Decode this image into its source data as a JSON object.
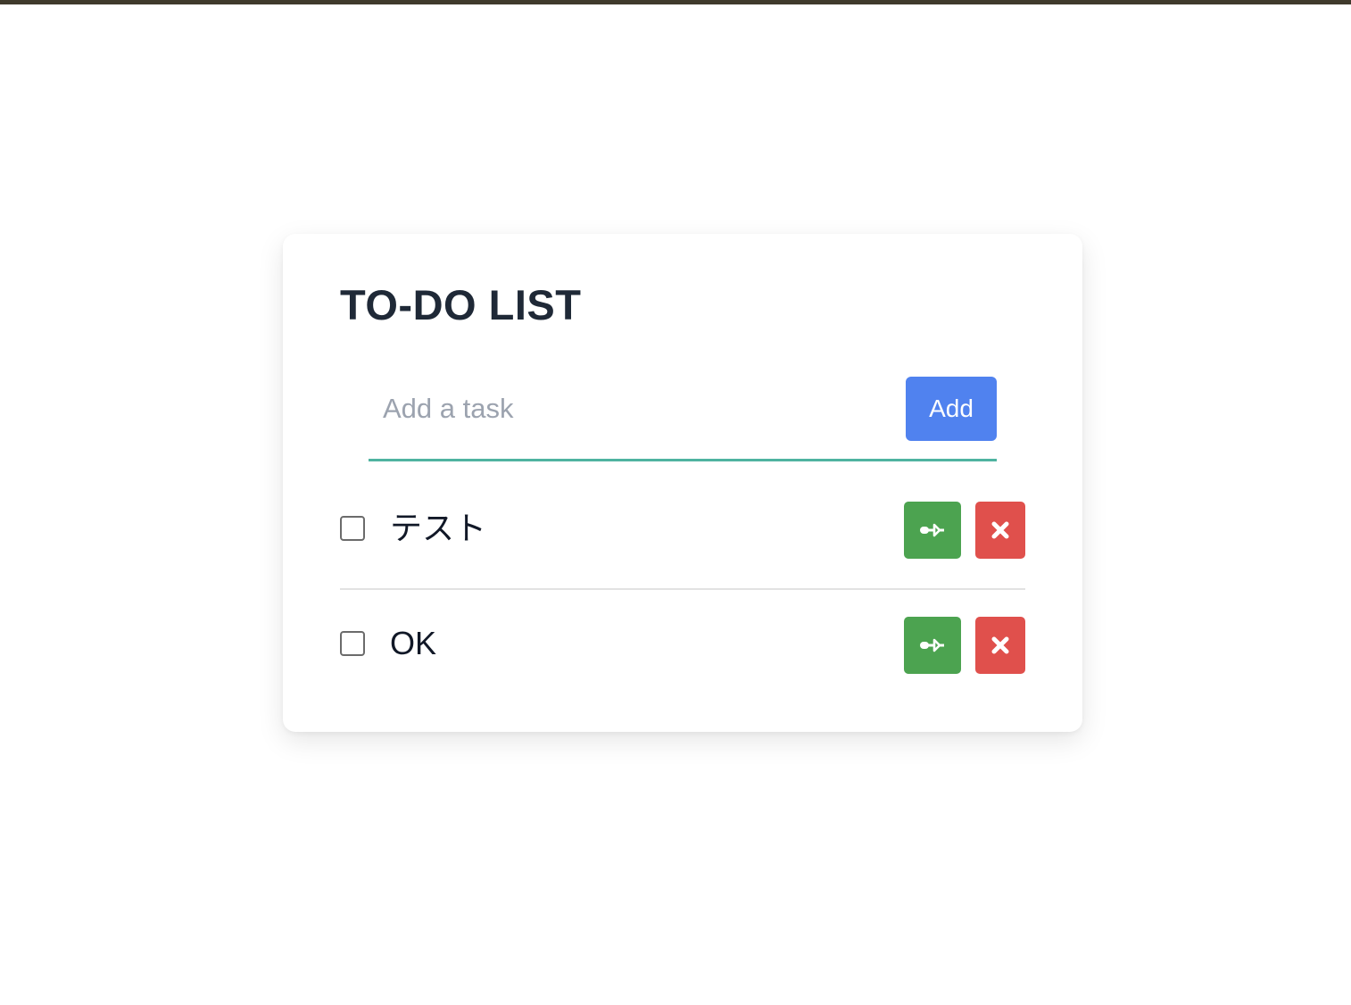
{
  "app": {
    "title": "TO-DO LIST"
  },
  "form": {
    "input_value": "",
    "input_placeholder": "Add a task",
    "add_label": "Add"
  },
  "todos": [
    {
      "text": "テスト",
      "checked": false,
      "edit_icon": "key-icon",
      "delete_icon": "close-icon"
    },
    {
      "text": "OK",
      "checked": false,
      "edit_icon": "key-icon",
      "delete_icon": "close-icon"
    }
  ],
  "colors": {
    "top_bar": "#3f3a2c",
    "title": "#1f2937",
    "accent_underline": "#4fb3a0",
    "add_button": "#5082ef",
    "edit_button": "#4ca350",
    "delete_button": "#e0504c",
    "placeholder": "#9ca3af"
  }
}
